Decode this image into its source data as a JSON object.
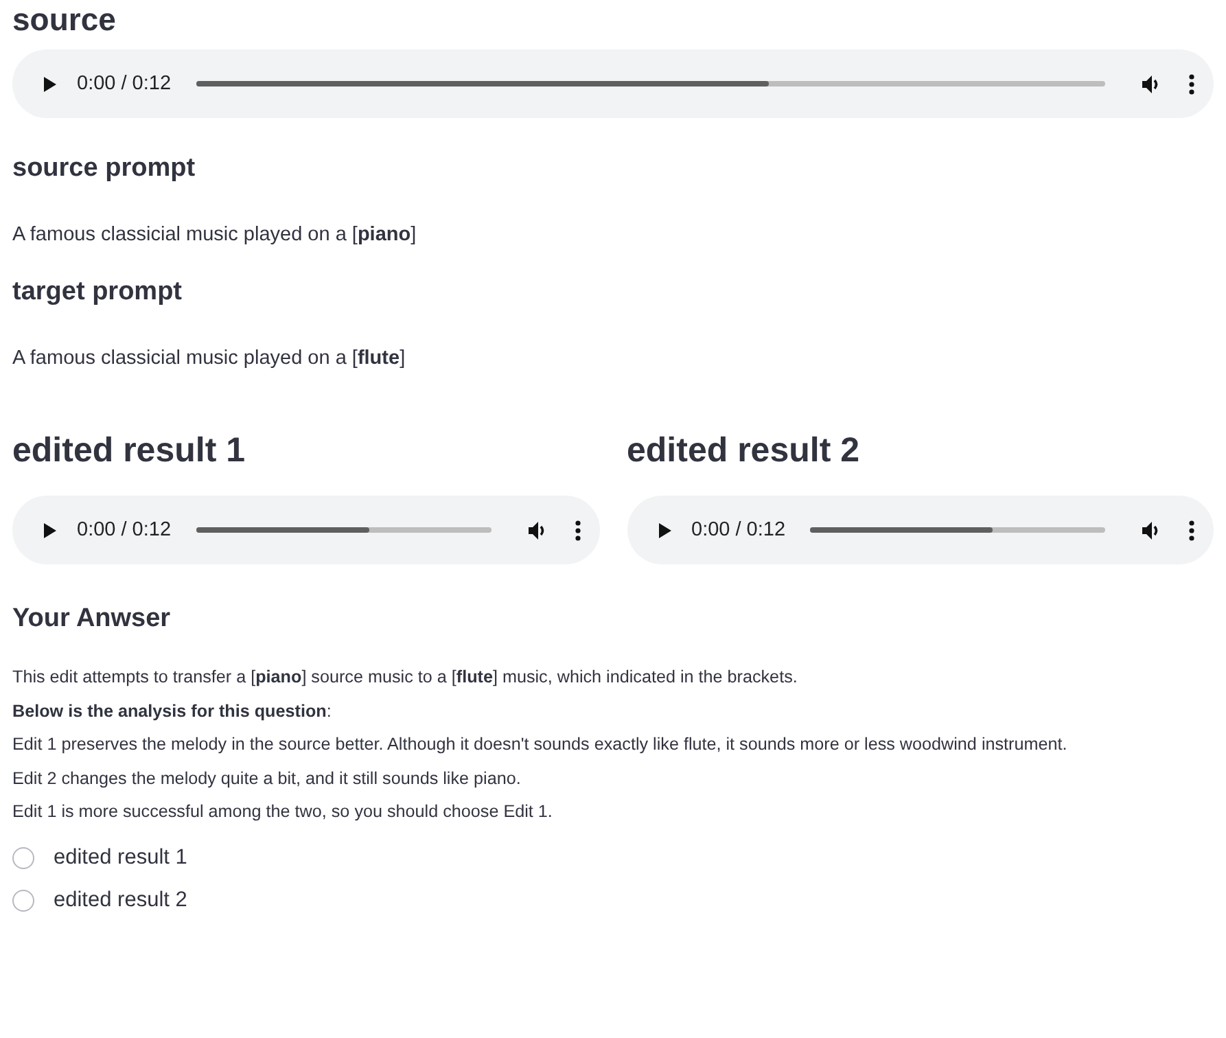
{
  "source": {
    "heading": "source",
    "player": {
      "time": "0:00 / 0:12",
      "level": 0.63
    }
  },
  "source_prompt": {
    "heading": "source prompt",
    "text": "A famous classicial music played on a [**piano**]"
  },
  "target_prompt": {
    "heading": "target prompt",
    "text": "A famous classicial music played on a [**flute**]"
  },
  "results": [
    {
      "heading": "edited result 1",
      "player": {
        "time": "0:00 / 0:12",
        "level": 0.59
      }
    },
    {
      "heading": "edited result 2",
      "player": {
        "time": "0:00 / 0:12",
        "level": 0.62
      }
    }
  ],
  "answer": {
    "heading": "Your Anwser",
    "paragraphs": [
      "This edit attempts to transfer a [**piano**] source music to a [**flute**] music, which indicated in the brackets.",
      "**Below is the analysis for this question**:",
      "Edit 1 preserves the melody in the source better. Although it doesn't sounds exactly like flute, it sounds more or less woodwind instrument.",
      "Edit 2 changes the melody quite a bit, and it still sounds like piano.",
      "Edit 1 is more successful among the two, so you should choose Edit 1."
    ],
    "options": [
      {
        "label": "edited result 1",
        "selected": false
      },
      {
        "label": "edited result 2",
        "selected": false
      }
    ]
  }
}
